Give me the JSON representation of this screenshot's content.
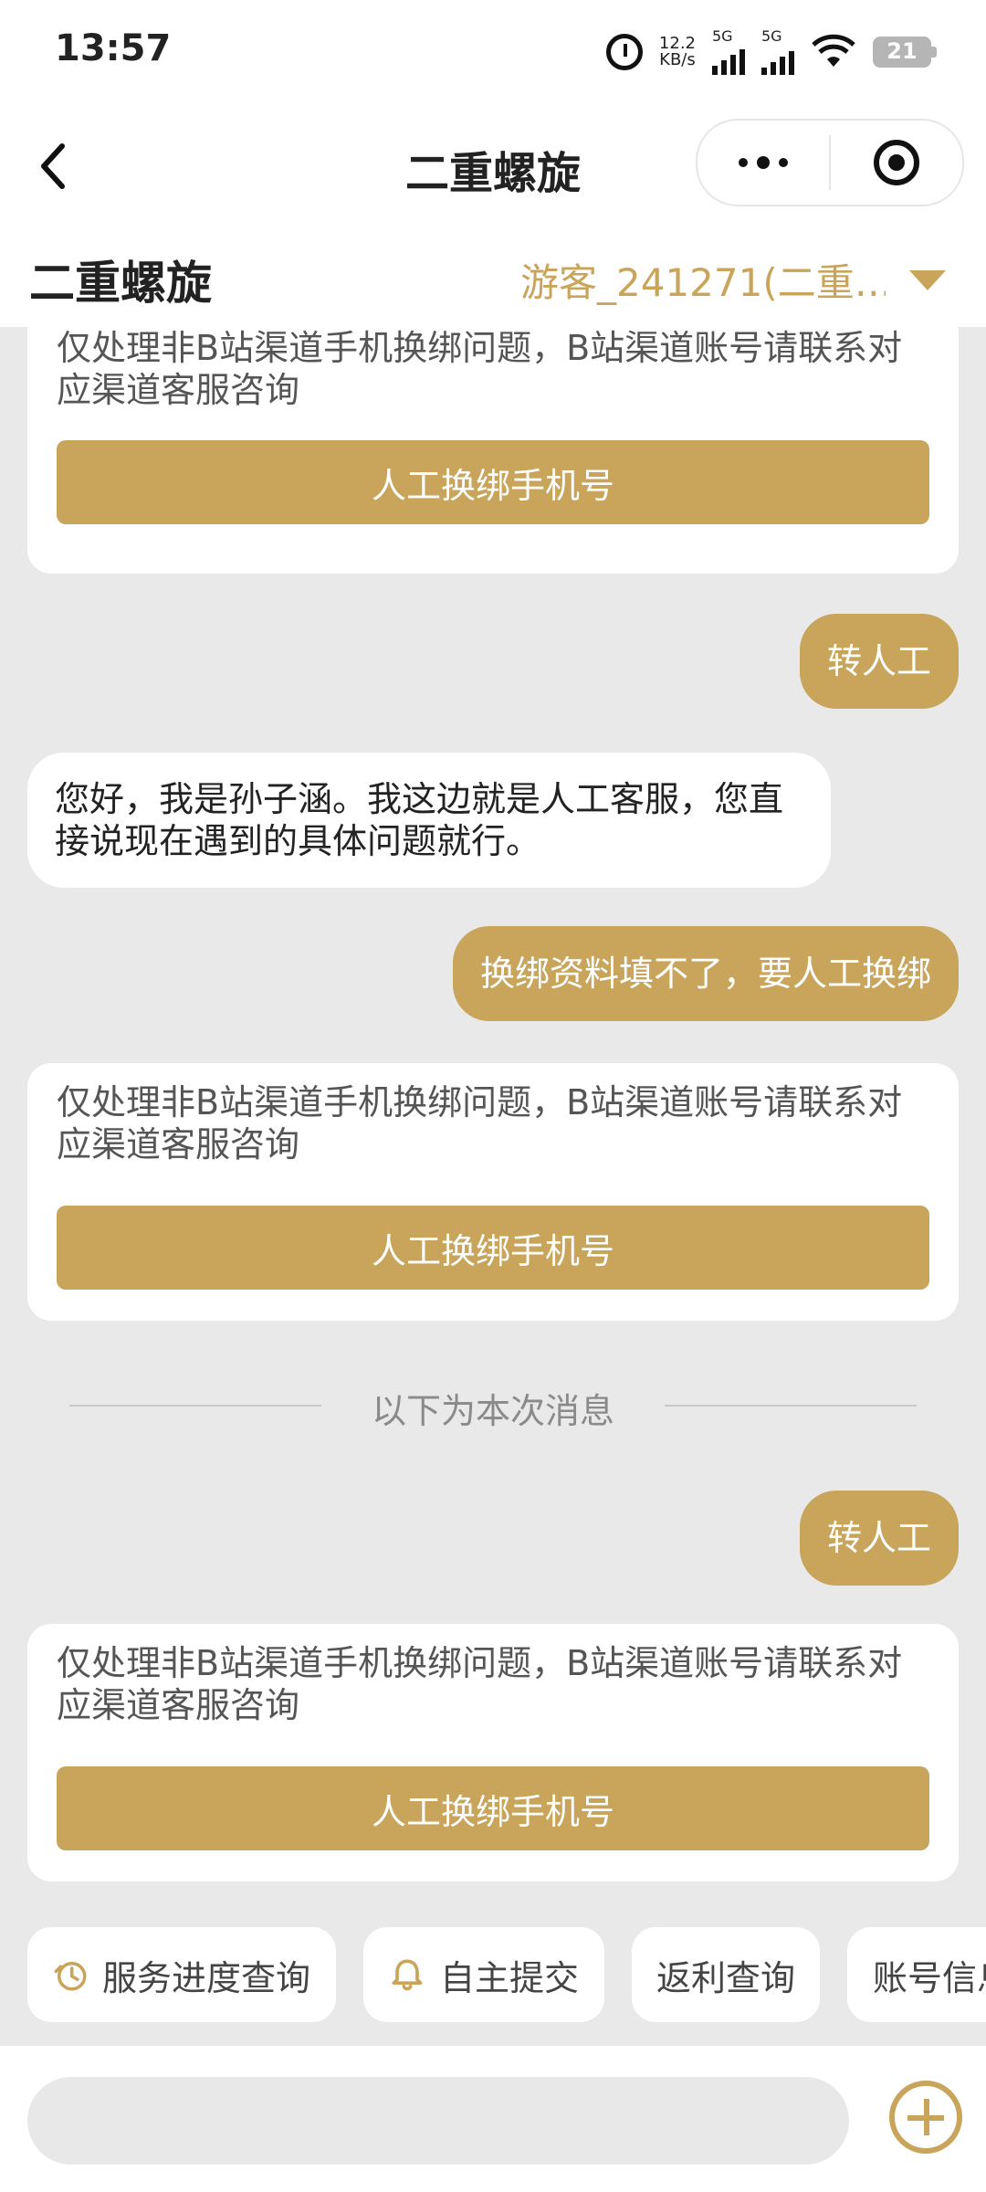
{
  "status_bar": {
    "time": "13:57",
    "network_speed_top": "12.2",
    "network_speed_bottom": "KB/s",
    "sim1_label": "5G",
    "sim2_label": "5G",
    "battery": "21"
  },
  "nav": {
    "title": "二重螺旋"
  },
  "header": {
    "game_title": "二重螺旋",
    "account": "游客_241271(二重…"
  },
  "messages": {
    "card1_text": "仅处理非B站渠道手机换绑问题，B站渠道账号请联系对应渠道客服咨询",
    "card1_button": "人工换绑手机号",
    "user_msg1": "转人工",
    "agent_msg": "您好，我是孙子涵。我这边就是人工客服，您直接说现在遇到的具体问题就行。",
    "user_msg2": "换绑资料填不了，要人工换绑",
    "card2_text": "仅处理非B站渠道手机换绑问题，B站渠道账号请联系对应渠道客服咨询",
    "card2_button": "人工换绑手机号",
    "separator": "以下为本次消息",
    "user_msg3": "转人工",
    "card3_text": "仅处理非B站渠道手机换绑问题，B站渠道账号请联系对应渠道客服咨询",
    "card3_button": "人工换绑手机号"
  },
  "quick_actions": [
    {
      "label": "服务进度查询",
      "icon": "clock-icon"
    },
    {
      "label": "自主提交",
      "icon": "bell-icon"
    },
    {
      "label": "返利查询",
      "icon": ""
    },
    {
      "label": "账号信息",
      "icon": ""
    }
  ],
  "input": {
    "placeholder": ""
  },
  "colors": {
    "accent": "#C9A45B",
    "background": "#E9E9E9"
  }
}
